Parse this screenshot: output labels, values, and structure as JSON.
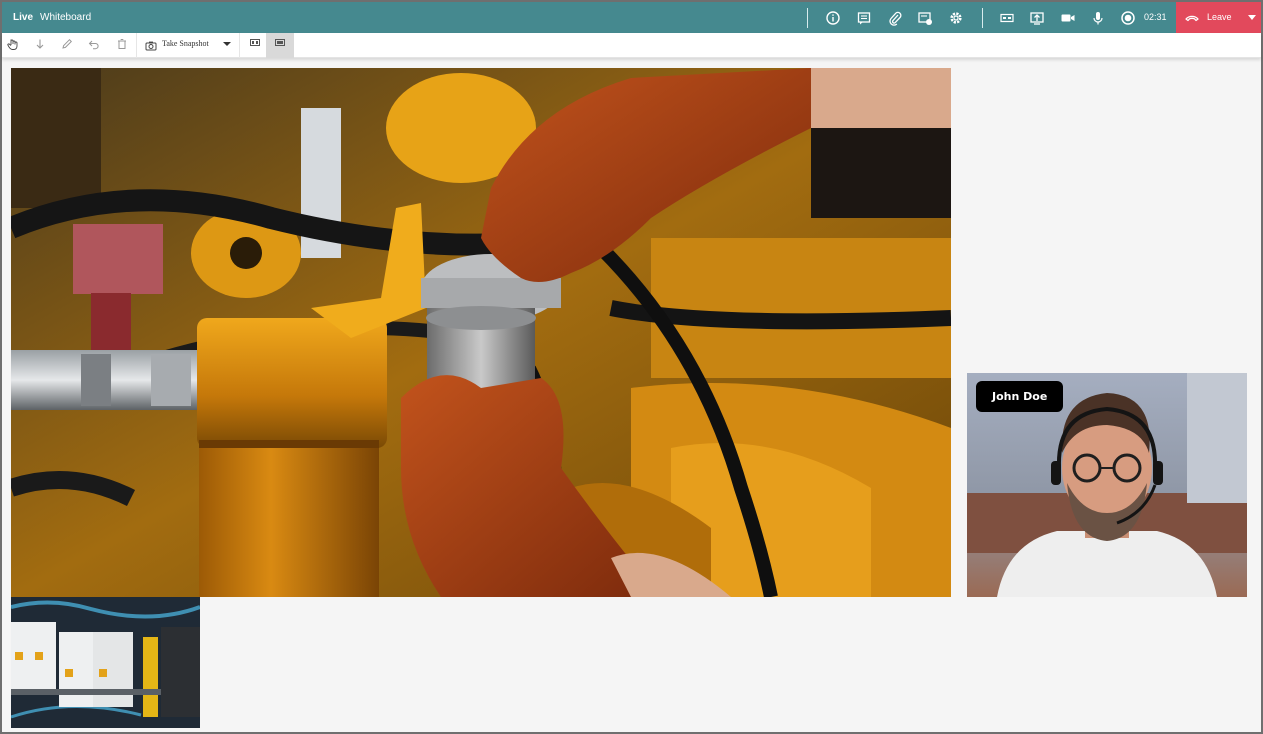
{
  "header": {
    "tabs": [
      {
        "label": "Live",
        "active": true
      },
      {
        "label": "Whiteboard",
        "active": false
      }
    ],
    "icons": [
      "info-icon",
      "chat-icon",
      "attachment-icon",
      "media-settings-icon",
      "settings-icon",
      "captions-icon",
      "screen-share-icon",
      "video-camera-icon",
      "microphone-icon",
      "record-icon"
    ],
    "timer": "02:31",
    "leave_label": "Leave",
    "colors": {
      "bar": "#45898f",
      "leave": "#e2495c"
    }
  },
  "toolbar": {
    "tools": [
      "pointer-tool-icon",
      "download-icon",
      "pen-tool-icon",
      "undo-icon",
      "trash-icon"
    ],
    "snapshot_label": "Take Snapshot",
    "layouts": [
      "layout-grid-icon",
      "layout-focus-icon"
    ],
    "active_layout_index": 1
  },
  "participant": {
    "name": "John Doe"
  },
  "media": {
    "main": "hands-in-orange-gloves-fixing-yellow-engine-filter",
    "thumbnail": "electrical-circuit-breakers-panel",
    "camera": "man-with-glasses-and-headset"
  }
}
